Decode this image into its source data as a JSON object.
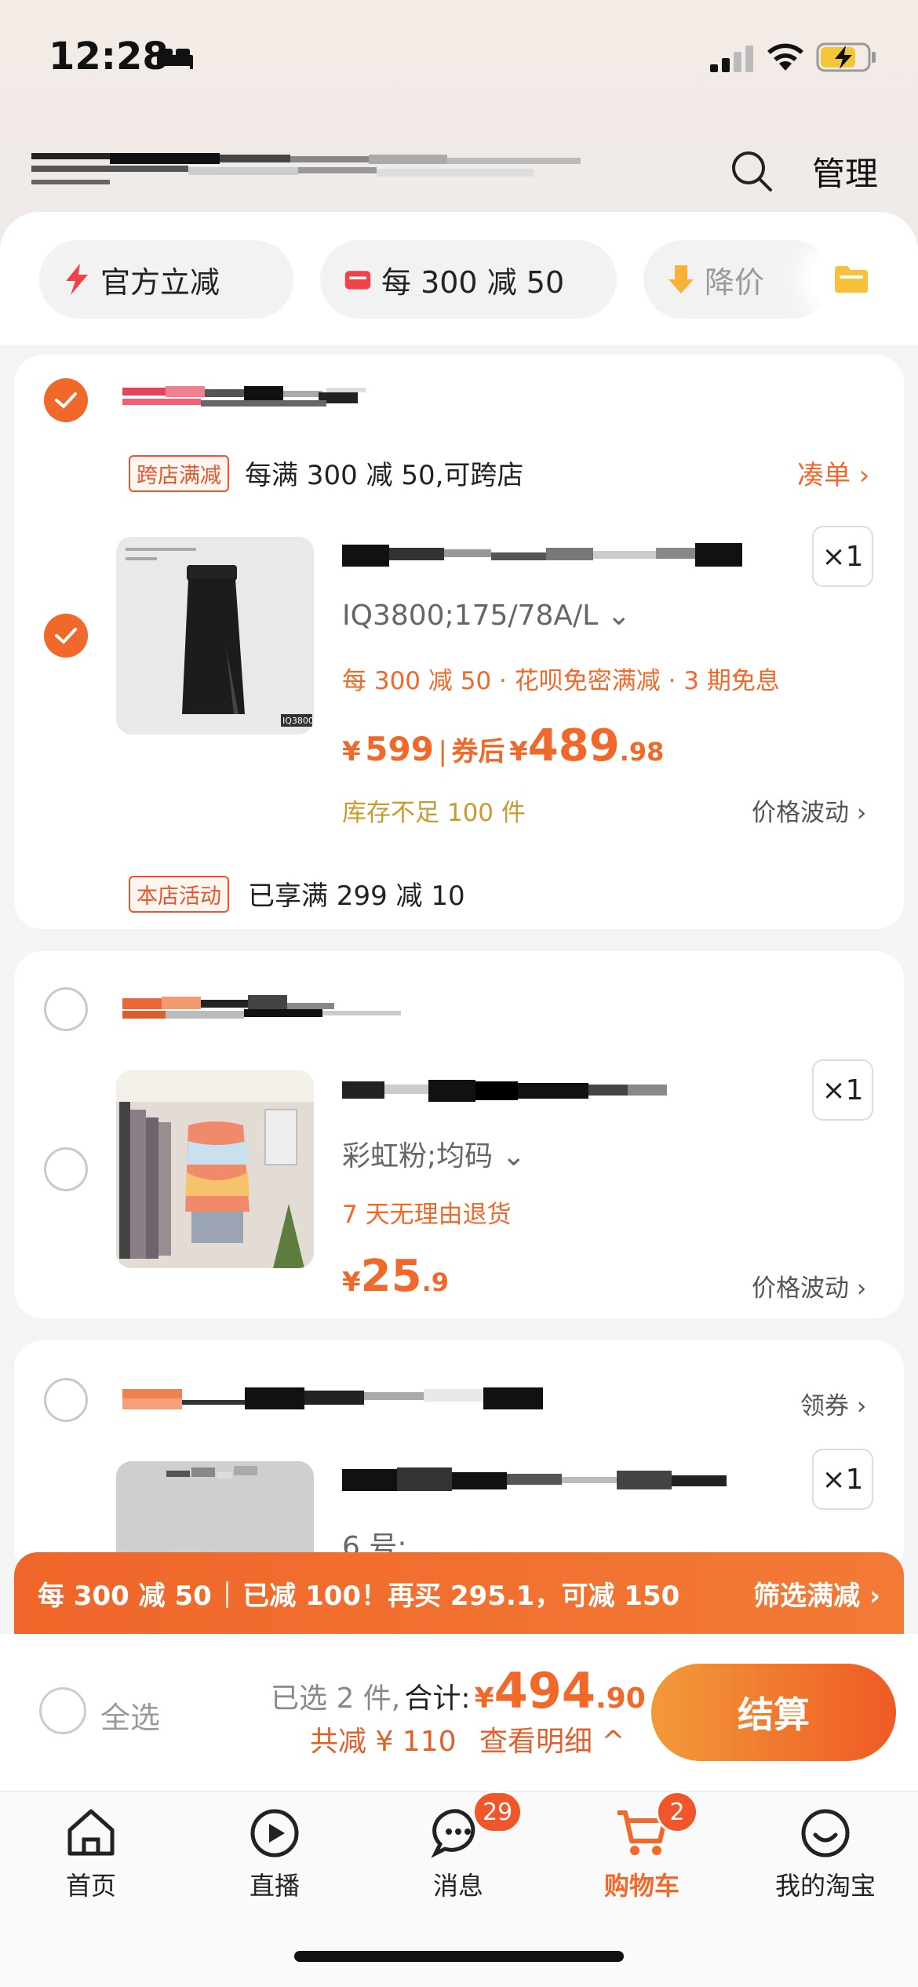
{
  "status_bar": {
    "time": "12:28"
  },
  "header": {
    "manage_label": "管理"
  },
  "filters": [
    {
      "label": "官方立减",
      "icon": "lightning-icon"
    },
    {
      "label": "每 300 减 50",
      "icon": "coupon-icon"
    },
    {
      "label": "降价",
      "icon": "arrow-down-icon"
    }
  ],
  "store1": {
    "cross_store_tag": "跨店满减",
    "promo_text": "每满 300 减 50,可跨店",
    "combine_link": "凑单 ›",
    "item": {
      "thumb_label": "IQ3800",
      "qty": "×1",
      "sku": "IQ3800;175/78A/L ⌄",
      "promo": "每 300 减 50 · 花呗免密满减 · 3 期免息",
      "price_symbol": "¥",
      "price": "599",
      "coupon_label": "券后",
      "coupon_symbol": "¥",
      "coupon_price_int": "489",
      "coupon_price_dec": ".98",
      "stock": "库存不足 100 件",
      "price_fluct": "价格波动 ›"
    },
    "store_activity_tag": "本店活动",
    "store_activity_text": "已享满 299 减 10"
  },
  "store2": {
    "item": {
      "qty": "×1",
      "sku": "彩虹粉;均码 ⌄",
      "promo": "7 天无理由退货",
      "price_symbol": "¥",
      "price_int": "25",
      "price_dec": ".9",
      "price_fluct": "价格波动 ›"
    }
  },
  "store3": {
    "coupon_link": "领券 ›",
    "item": {
      "qty": "×1",
      "sku_partial": "6 号;…"
    }
  },
  "promo_banner": {
    "left": "每 300 减 50",
    "middle": "已减 100！再买 295.1，可减 150",
    "right": "筛选满减 ›"
  },
  "checkout": {
    "select_all": "全选",
    "selected_count": "已选 2 件,",
    "total_label": "合计:",
    "total_symbol": "¥",
    "total_int": "494",
    "total_dec": ".90",
    "saved": "共减 ¥ 110",
    "details": "查看明细 ^",
    "button": "结算"
  },
  "tabs": [
    {
      "label": "首页",
      "icon": "home-icon"
    },
    {
      "label": "直播",
      "icon": "live-icon"
    },
    {
      "label": "消息",
      "icon": "message-icon",
      "badge": "29"
    },
    {
      "label": "购物车",
      "icon": "cart-icon",
      "badge": "2",
      "active": true
    },
    {
      "label": "我的淘宝",
      "icon": "profile-icon"
    }
  ],
  "colors": {
    "accent": "#f0692a",
    "stock": "#c79b2e",
    "banner": "#f0662a"
  }
}
